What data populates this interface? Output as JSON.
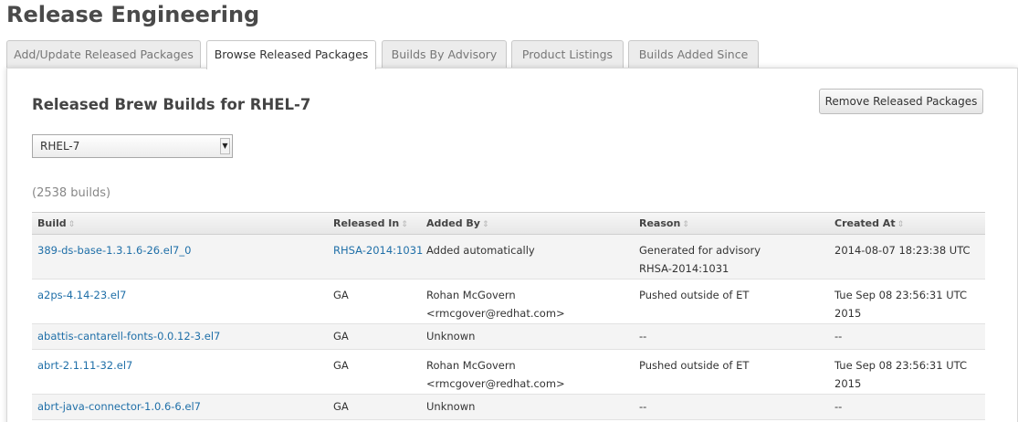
{
  "page": {
    "title": "Release Engineering"
  },
  "tabs": [
    {
      "label": "Add/Update Released Packages",
      "active": false
    },
    {
      "label": "Browse Released Packages",
      "active": true
    },
    {
      "label": "Builds By Advisory",
      "active": false
    },
    {
      "label": "Product Listings",
      "active": false
    },
    {
      "label": "Builds Added Since",
      "active": false
    }
  ],
  "main": {
    "heading": "Released Brew Builds for RHEL-7",
    "remove_button": "Remove Released Packages",
    "product_select": {
      "value": "RHEL-7",
      "arrow": "▼"
    },
    "count": "(2538 builds)"
  },
  "table": {
    "sort_icon": "⇕",
    "columns": [
      {
        "label": "Build"
      },
      {
        "label": "Released In"
      },
      {
        "label": "Added By"
      },
      {
        "label": "Reason"
      },
      {
        "label": "Created At"
      }
    ],
    "rows": [
      {
        "build": "389-ds-base-1.3.1.6-26.el7_0",
        "released_in": "RHSA-2014:1031",
        "released_in_link": true,
        "added_by": [
          "Added automatically"
        ],
        "reason": [
          "Generated for advisory",
          "RHSA-2014:1031"
        ],
        "created_at": [
          "2014-08-07 18:23:38 UTC"
        ]
      },
      {
        "build": "a2ps-4.14-23.el7",
        "released_in": "GA",
        "released_in_link": false,
        "added_by": [
          "Rohan McGovern",
          "<rmcgover@redhat.com>"
        ],
        "reason": [
          "Pushed outside of ET"
        ],
        "created_at": [
          "Tue Sep 08 23:56:31 UTC",
          "2015"
        ]
      },
      {
        "build": "abattis-cantarell-fonts-0.0.12-3.el7",
        "released_in": "GA",
        "released_in_link": false,
        "added_by": [
          "Unknown"
        ],
        "reason": [
          "--"
        ],
        "created_at": [
          "--"
        ]
      },
      {
        "build": "abrt-2.1.11-32.el7",
        "released_in": "GA",
        "released_in_link": false,
        "added_by": [
          "Rohan McGovern",
          "<rmcgover@redhat.com>"
        ],
        "reason": [
          "Pushed outside of ET"
        ],
        "created_at": [
          "Tue Sep 08 23:56:31 UTC",
          "2015"
        ]
      },
      {
        "build": "abrt-java-connector-1.0.6-6.el7",
        "released_in": "GA",
        "released_in_link": false,
        "added_by": [
          "Unknown"
        ],
        "reason": [
          "--"
        ],
        "created_at": [
          "--"
        ]
      }
    ]
  }
}
